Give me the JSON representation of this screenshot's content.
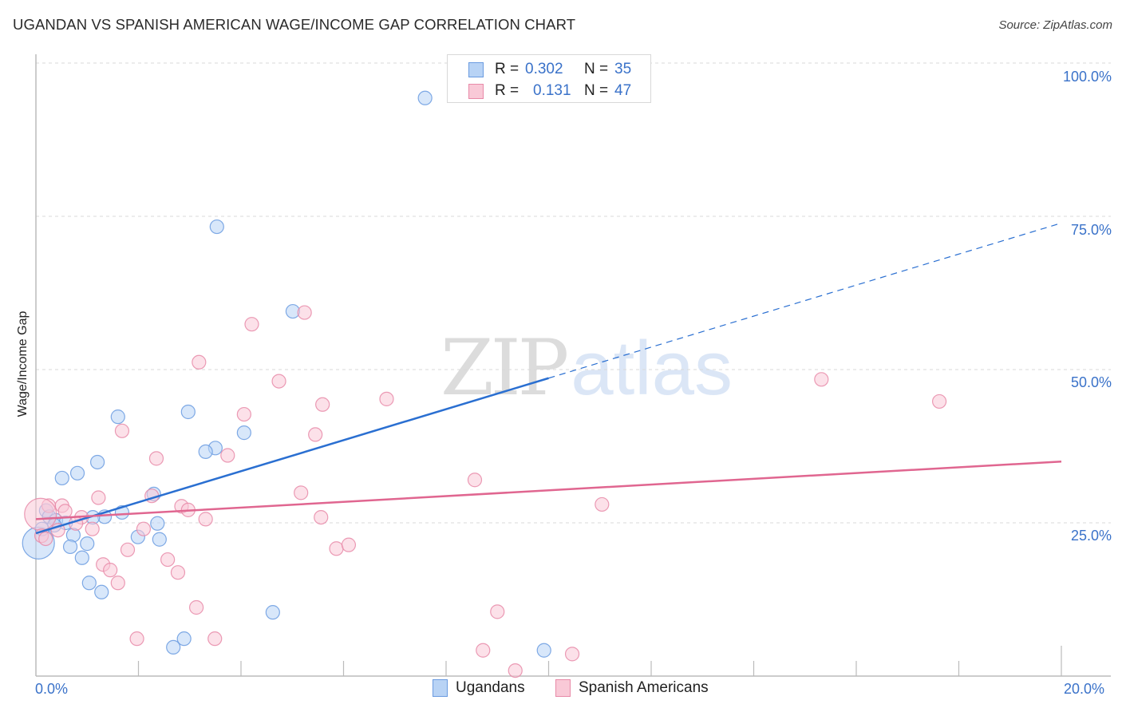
{
  "header": {
    "title": "UGANDAN VS SPANISH AMERICAN WAGE/INCOME GAP CORRELATION CHART",
    "source": "Source: ZipAtlas.com"
  },
  "watermark": {
    "zip": "ZIP",
    "atlas": "atlas"
  },
  "colors": {
    "ugandans_fill": "#b8d3f5",
    "ugandans_stroke": "#6a9be0",
    "ugandans_line": "#2a6fd1",
    "spanish_fill": "#f9c9d7",
    "spanish_stroke": "#e88aa8",
    "spanish_line": "#e06690",
    "axis_label": "#3a72c9",
    "grid": "#d9d9d9"
  },
  "legend": {
    "rows": [
      {
        "r_label": "R =",
        "r_value": "0.302",
        "n_label": "N =",
        "n_value": "35"
      },
      {
        "r_label": "R =",
        "r_value": "0.131",
        "n_label": "N =",
        "n_value": "47"
      }
    ]
  },
  "bottom_legend": [
    "Ugandans",
    "Spanish Americans"
  ],
  "chart_data": {
    "type": "scatter",
    "title": "UGANDAN VS SPANISH AMERICAN WAGE/INCOME GAP CORRELATION CHART",
    "xlabel": "",
    "ylabel": "Wage/Income Gap",
    "xlim": [
      0,
      20
    ],
    "ylim": [
      0,
      100
    ],
    "x_tick_labels": [
      "0.0%",
      "20.0%"
    ],
    "y_ticks": [
      25,
      50,
      75,
      100
    ],
    "y_tick_labels": [
      "25.0%",
      "50.0%",
      "75.0%",
      "100.0%"
    ],
    "grid": "horizontal dashed",
    "legend_position": "top-center",
    "series": [
      {
        "name": "Ugandans",
        "R": 0.302,
        "N": 35,
        "trendline": {
          "x": [
            0,
            10
          ],
          "y": [
            23.3,
            48.6
          ],
          "dashed_extension_to": [
            20,
            73.9
          ]
        },
        "points": [
          [
            7.59,
            94.3
          ],
          [
            3.53,
            73.3
          ],
          [
            5.01,
            59.5
          ],
          [
            2.97,
            43.1
          ],
          [
            1.6,
            42.3
          ],
          [
            4.06,
            39.7
          ],
          [
            3.5,
            37.2
          ],
          [
            3.31,
            36.6
          ],
          [
            1.2,
            34.9
          ],
          [
            0.81,
            33.1
          ],
          [
            0.51,
            32.3
          ],
          [
            2.3,
            29.7
          ],
          [
            1.68,
            26.7
          ],
          [
            1.34,
            26.0
          ],
          [
            1.11,
            25.9
          ],
          [
            0.2,
            27.0
          ],
          [
            0.26,
            26.0
          ],
          [
            0.39,
            25.4
          ],
          [
            0.58,
            25.0
          ],
          [
            0.36,
            24.6
          ],
          [
            2.37,
            24.9
          ],
          [
            1.99,
            22.7
          ],
          [
            0.73,
            23.0
          ],
          [
            2.41,
            22.3
          ],
          [
            1.0,
            21.6
          ],
          [
            0.67,
            21.1
          ],
          [
            0.05,
            21.7
          ],
          [
            0.9,
            19.3
          ],
          [
            1.04,
            15.2
          ],
          [
            1.28,
            13.7
          ],
          [
            4.62,
            10.4
          ],
          [
            2.89,
            6.1
          ],
          [
            2.68,
            4.7
          ],
          [
            9.91,
            4.2
          ],
          [
            0.12,
            24.0
          ]
        ]
      },
      {
        "name": "Spanish Americans",
        "R": 0.131,
        "N": 47,
        "trendline": {
          "x": [
            0,
            20
          ],
          "y": [
            25.6,
            35.0
          ]
        },
        "points": [
          [
            5.24,
            59.3
          ],
          [
            4.21,
            57.4
          ],
          [
            3.18,
            51.2
          ],
          [
            4.74,
            48.1
          ],
          [
            15.32,
            48.4
          ],
          [
            6.84,
            45.2
          ],
          [
            17.62,
            44.8
          ],
          [
            5.59,
            44.3
          ],
          [
            4.06,
            42.7
          ],
          [
            1.68,
            40.0
          ],
          [
            5.45,
            39.4
          ],
          [
            3.74,
            36.0
          ],
          [
            2.35,
            35.5
          ],
          [
            8.56,
            32.0
          ],
          [
            1.22,
            29.1
          ],
          [
            5.17,
            29.9
          ],
          [
            2.26,
            29.4
          ],
          [
            11.04,
            28.0
          ],
          [
            2.84,
            27.7
          ],
          [
            2.97,
            27.1
          ],
          [
            0.25,
            27.8
          ],
          [
            0.51,
            27.8
          ],
          [
            0.57,
            26.9
          ],
          [
            0.89,
            25.9
          ],
          [
            3.31,
            25.6
          ],
          [
            5.56,
            25.9
          ],
          [
            0.09,
            26.4
          ],
          [
            0.78,
            24.9
          ],
          [
            1.1,
            24.0
          ],
          [
            2.1,
            24.0
          ],
          [
            0.43,
            23.8
          ],
          [
            0.11,
            22.9
          ],
          [
            0.19,
            22.4
          ],
          [
            5.86,
            20.8
          ],
          [
            6.1,
            21.4
          ],
          [
            1.79,
            20.6
          ],
          [
            2.57,
            19.0
          ],
          [
            1.31,
            18.2
          ],
          [
            1.45,
            17.3
          ],
          [
            2.77,
            16.9
          ],
          [
            1.6,
            15.2
          ],
          [
            3.13,
            11.2
          ],
          [
            9.0,
            10.5
          ],
          [
            1.97,
            6.1
          ],
          [
            3.49,
            6.1
          ],
          [
            8.72,
            4.2
          ],
          [
            10.46,
            3.6
          ]
        ]
      }
    ],
    "extra_points": {
      "Spanish Americans": [
        [
          9.35,
          0.9
        ]
      ]
    }
  }
}
